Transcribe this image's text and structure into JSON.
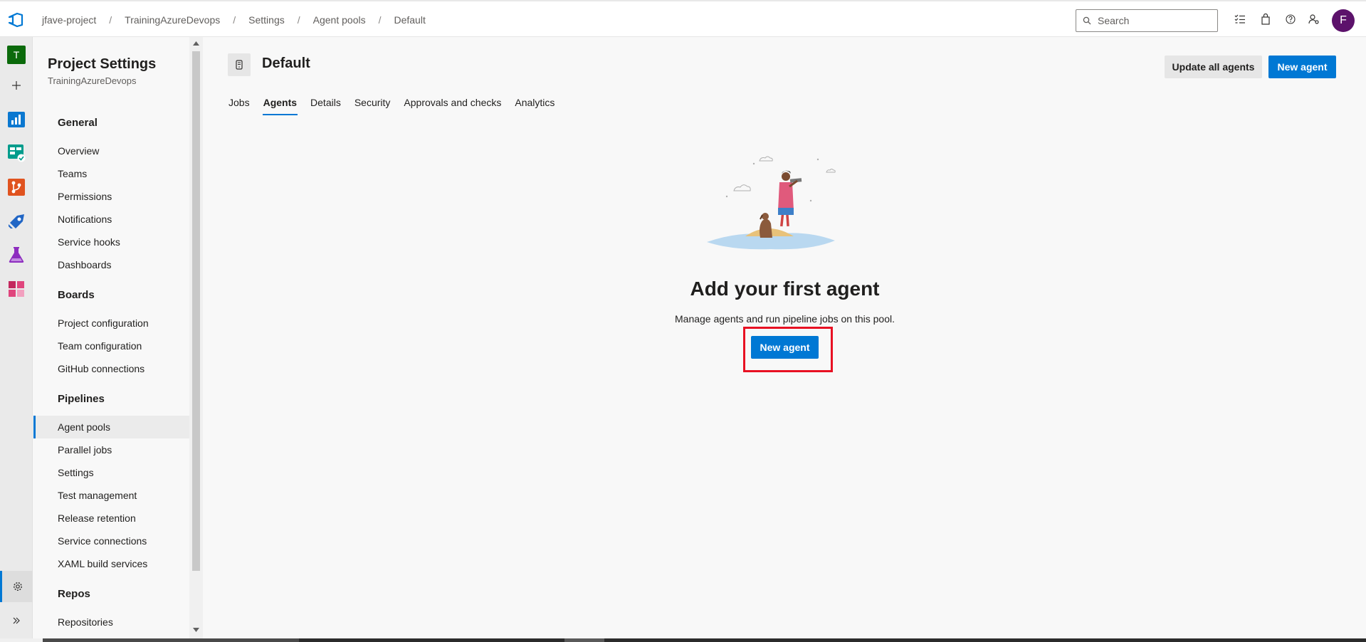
{
  "header": {
    "breadcrumbs": [
      "jfave-project",
      "TrainingAzureDevops",
      "Settings",
      "Agent pools",
      "Default"
    ],
    "breadcrumb_separator": "/",
    "search_placeholder": "Search",
    "avatar_initial": "F",
    "avatar_color": "#5c126b"
  },
  "rail": {
    "project_initial": "T",
    "icons": [
      "add-icon",
      "overview-icon",
      "boards-icon",
      "repos-icon",
      "pipelines-icon",
      "test-plans-icon",
      "artifacts-icon"
    ],
    "bottom_icons": [
      "gear-icon",
      "expand-icon"
    ]
  },
  "sidebar": {
    "title": "Project Settings",
    "subtitle": "TrainingAzureDevops",
    "sections": [
      {
        "label": "General",
        "items": [
          "Overview",
          "Teams",
          "Permissions",
          "Notifications",
          "Service hooks",
          "Dashboards"
        ]
      },
      {
        "label": "Boards",
        "items": [
          "Project configuration",
          "Team configuration",
          "GitHub connections"
        ]
      },
      {
        "label": "Pipelines",
        "items": [
          "Agent pools",
          "Parallel jobs",
          "Settings",
          "Test management",
          "Release retention",
          "Service connections",
          "XAML build services"
        ]
      },
      {
        "label": "Repos",
        "items": [
          "Repositories"
        ]
      }
    ],
    "active_item": "Agent pools"
  },
  "main": {
    "title": "Default",
    "update_all_label": "Update all agents",
    "new_agent_label": "New agent",
    "tabs": [
      "Jobs",
      "Agents",
      "Details",
      "Security",
      "Approvals and checks",
      "Analytics"
    ],
    "active_tab": "Agents",
    "empty_state": {
      "title": "Add your first agent",
      "description": "Manage agents and run pipeline jobs on this pool.",
      "button_label": "New agent"
    }
  },
  "colors": {
    "accent": "#0078d4",
    "highlight": "#e81123"
  }
}
